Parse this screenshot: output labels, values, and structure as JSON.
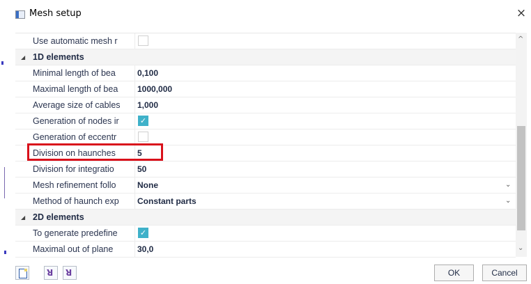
{
  "window": {
    "title": "Mesh setup",
    "close_glyph": "×"
  },
  "rows": [
    {
      "kind": "prop",
      "label": "Use automatic mesh r",
      "checkbox": false
    },
    {
      "kind": "section",
      "label": "1D elements"
    },
    {
      "kind": "prop",
      "label": "Minimal length of bea",
      "value": "0,100"
    },
    {
      "kind": "prop",
      "label": "Maximal length of bea",
      "value": "1000,000"
    },
    {
      "kind": "prop",
      "label": "Average size of cables",
      "value": "1,000"
    },
    {
      "kind": "prop",
      "label": "Generation of nodes ir",
      "checkbox": true
    },
    {
      "kind": "prop",
      "label": "Generation of eccentr",
      "checkbox": false
    },
    {
      "kind": "prop",
      "label": "Division on haunches",
      "value": "5",
      "highlighted": true
    },
    {
      "kind": "prop",
      "label": "Division for integratio",
      "value": "50"
    },
    {
      "kind": "prop",
      "label": "Mesh refinement follo",
      "value": "None",
      "dropdown": true
    },
    {
      "kind": "prop",
      "label": "Method of haunch exp",
      "value": "Constant parts",
      "dropdown": true
    },
    {
      "kind": "section",
      "label": "2D elements"
    },
    {
      "kind": "prop",
      "label": "To generate predefine",
      "checkbox": true
    },
    {
      "kind": "prop",
      "label": "Maximal out of plane",
      "value": "30,0"
    }
  ],
  "buttons": {
    "ok": "OK",
    "cancel": "Cancel"
  },
  "icons": {
    "check": "✓",
    "dropdown": "⌄",
    "collapse": "◢",
    "scroll_up": "^",
    "scroll_down": "⌄"
  },
  "colors": {
    "highlight": "#d9111b",
    "checkbox_on": "#3fb1c9"
  }
}
